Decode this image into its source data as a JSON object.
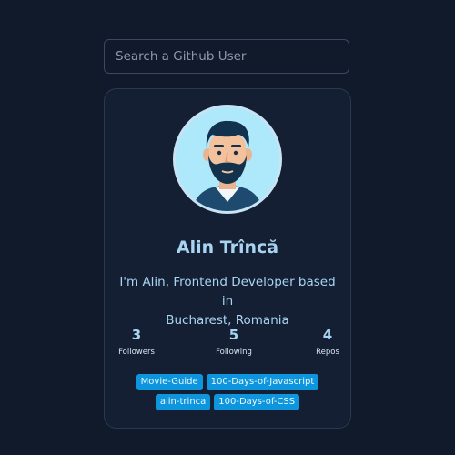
{
  "search": {
    "placeholder": "Search a Github User"
  },
  "profile": {
    "name": "Alin Trîncă",
    "bio_lines": [
      "I'm Alin, Frontend Developer based in",
      "Bucharest, Romania"
    ],
    "avatar_icon": "bearded-man-avatar"
  },
  "stats": [
    {
      "value": "3",
      "label": "Followers"
    },
    {
      "value": "5",
      "label": "Following"
    },
    {
      "value": "4",
      "label": "Repos"
    }
  ],
  "repos": [
    "Movie-Guide",
    "100-Days-of-Javascript",
    "alin-trinca",
    "100-Days-of-CSS"
  ],
  "colors": {
    "background": "#111a2b",
    "card": "#141f33",
    "accent_text": "#a8d4f2",
    "repo_badge": "#0d96de"
  }
}
